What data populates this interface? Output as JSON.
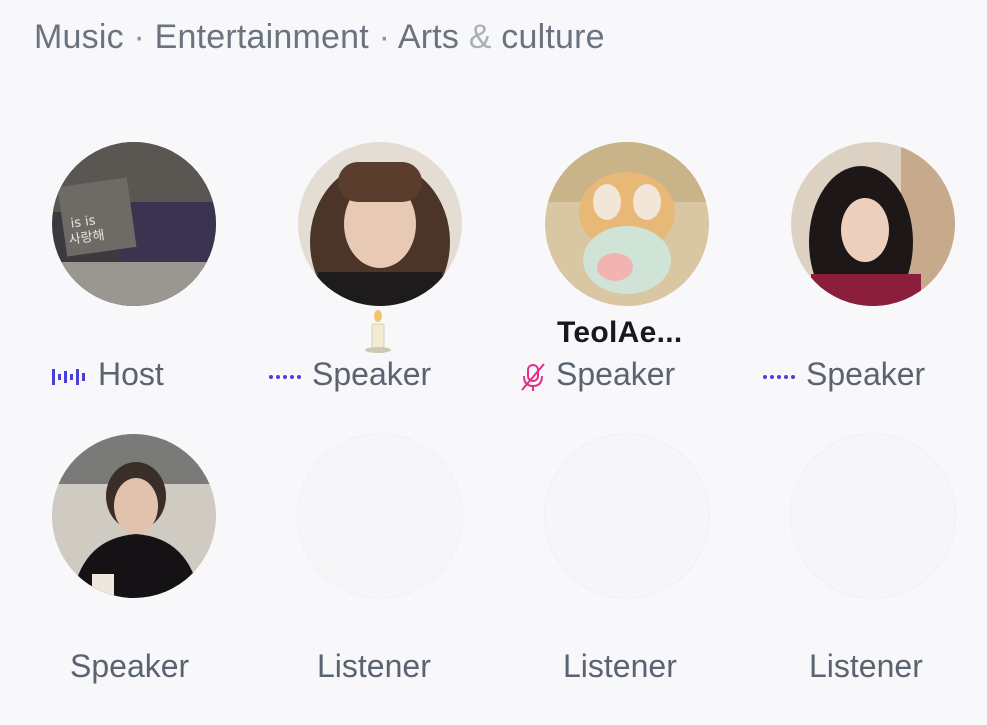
{
  "topics": [
    "Music",
    "Entertainment",
    "Arts",
    "culture"
  ],
  "topic_separator": "·",
  "topic_ampersand": "&",
  "participants": [
    {
      "role": "Host",
      "name": "",
      "status_icon": "speaking-waveform-icon",
      "accent": "#4a3fd8"
    },
    {
      "role": "Speaker",
      "name": "",
      "status_icon": "dotted-audio-icon",
      "accent": "#4a3fd8",
      "badge": "candle-icon"
    },
    {
      "role": "Speaker",
      "name": "TeolAe...",
      "status_icon": "muted-mic-icon",
      "accent": "#e0308a"
    },
    {
      "role": "Speaker",
      "name": "",
      "status_icon": "dotted-audio-icon",
      "accent": "#4a3fd8"
    },
    {
      "role": "Speaker",
      "name": ""
    },
    {
      "role": "Listener",
      "name": ""
    },
    {
      "role": "Listener",
      "name": ""
    },
    {
      "role": "Listener",
      "name": ""
    }
  ]
}
